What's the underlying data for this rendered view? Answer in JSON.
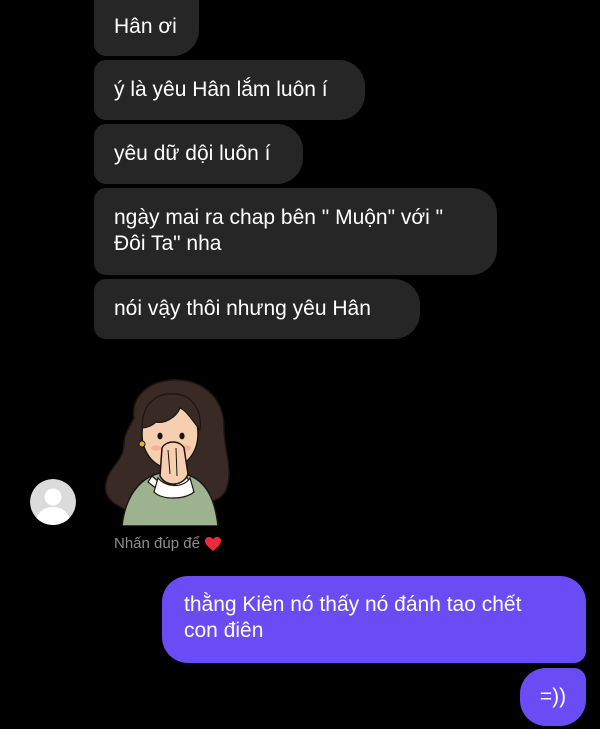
{
  "messages": {
    "incoming": [
      "Hân ơi",
      "ý là yêu Hân lắm luôn í",
      "yêu dữ dội luôn í",
      "ngày mai ra chap bên \" Muộn\" với \"\nĐôi Ta\" nha",
      "nói vậy thôi nhưng yêu Hân"
    ],
    "outgoing": [
      "thằng Kiên nó thấy nó đánh tao chết\ncon điên",
      "=))"
    ]
  },
  "reaction_hint": "Nhấn đúp để",
  "icons": {
    "reaction": "heart-icon",
    "avatar": "default-avatar-icon",
    "sticker": "girl-covering-mouth-sticker"
  },
  "colors": {
    "background": "#000000",
    "incoming_bubble": "#262626",
    "outgoing_bubble": "#6a4cf4",
    "hint_text": "#8e8e8e",
    "heart": "#ed2a3a"
  }
}
